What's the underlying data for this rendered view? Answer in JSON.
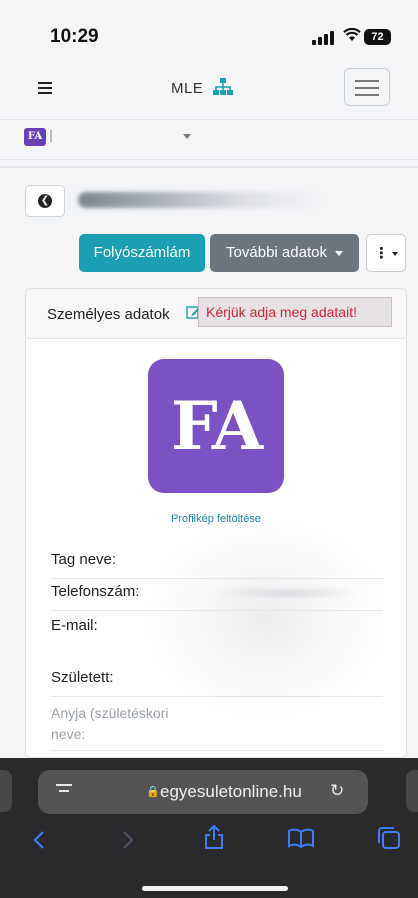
{
  "status_bar": {
    "time": "10:29",
    "battery": "72"
  },
  "nav": {
    "brand": "MLE"
  },
  "user": {
    "avatar_initials": "FA"
  },
  "buttons": {
    "account": "Folyószámlám",
    "more_data": "További adatok",
    "kebab": "⋮"
  },
  "card": {
    "title": "Személyes adatok",
    "warning": "Kérjük adja meg adatait!",
    "logo_text": "FA",
    "upload_link": "Profilkép feltöltése",
    "fields": {
      "name": "Tag neve:",
      "phone": "Telefonszám:",
      "email": "E-mail:",
      "born": "Született:",
      "mother_line1": "Anyja (születéskori",
      "mother_line2": "neve:"
    }
  },
  "browser": {
    "url": "egyesuletonline.hu"
  },
  "colors": {
    "teal": "#1a9fb3",
    "gray": "#6c757d",
    "warning": "#d0243a",
    "logo": "#7b52c4",
    "safari_blue": "#3e7df5"
  }
}
